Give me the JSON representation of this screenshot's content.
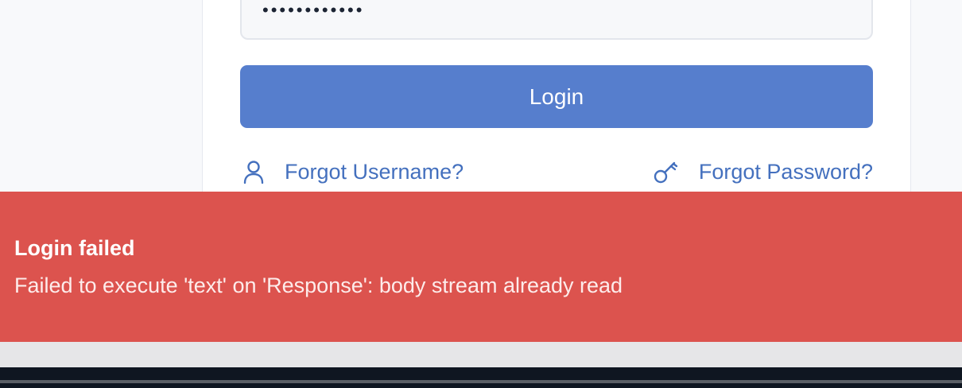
{
  "login_form": {
    "password_value": "••••••••••••",
    "login_button_label": "Login",
    "forgot_username_label": "Forgot Username?",
    "forgot_password_label": "Forgot Password?",
    "accent_color": "#567ecd",
    "link_color": "#4470be"
  },
  "toast": {
    "title": "Login failed",
    "message": "Failed to execute 'text' on 'Response': body stream already read",
    "background_color": "#dc534e"
  },
  "icons": {
    "forgot_username": "user-icon",
    "forgot_password": "key-icon"
  }
}
